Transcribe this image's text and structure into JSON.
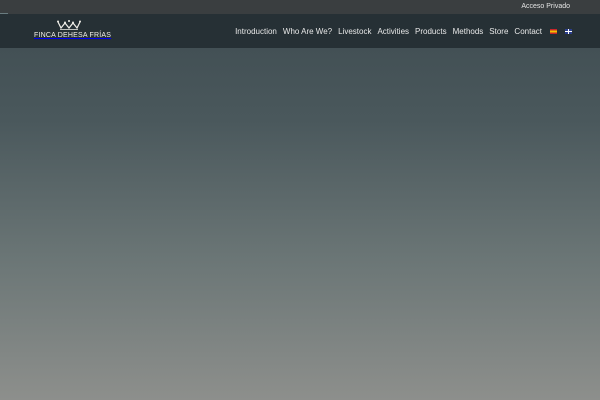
{
  "topbar": {
    "private_access": "Acceso Privado"
  },
  "brand": {
    "name": "FINCA DEHESA FRÍAS",
    "icon": "crown-icon"
  },
  "nav": {
    "items": [
      "Introduction",
      "Who Are We?",
      "Livestock",
      "Activities",
      "Products",
      "Methods",
      "Store",
      "Contact"
    ],
    "languages": [
      "es-flag-icon",
      "en-flag-icon"
    ]
  },
  "colors": {
    "topbar": "#3a3e40",
    "header": "#263035",
    "hero_top": "#3e4b50",
    "hero_bottom": "#8d8f8c"
  }
}
